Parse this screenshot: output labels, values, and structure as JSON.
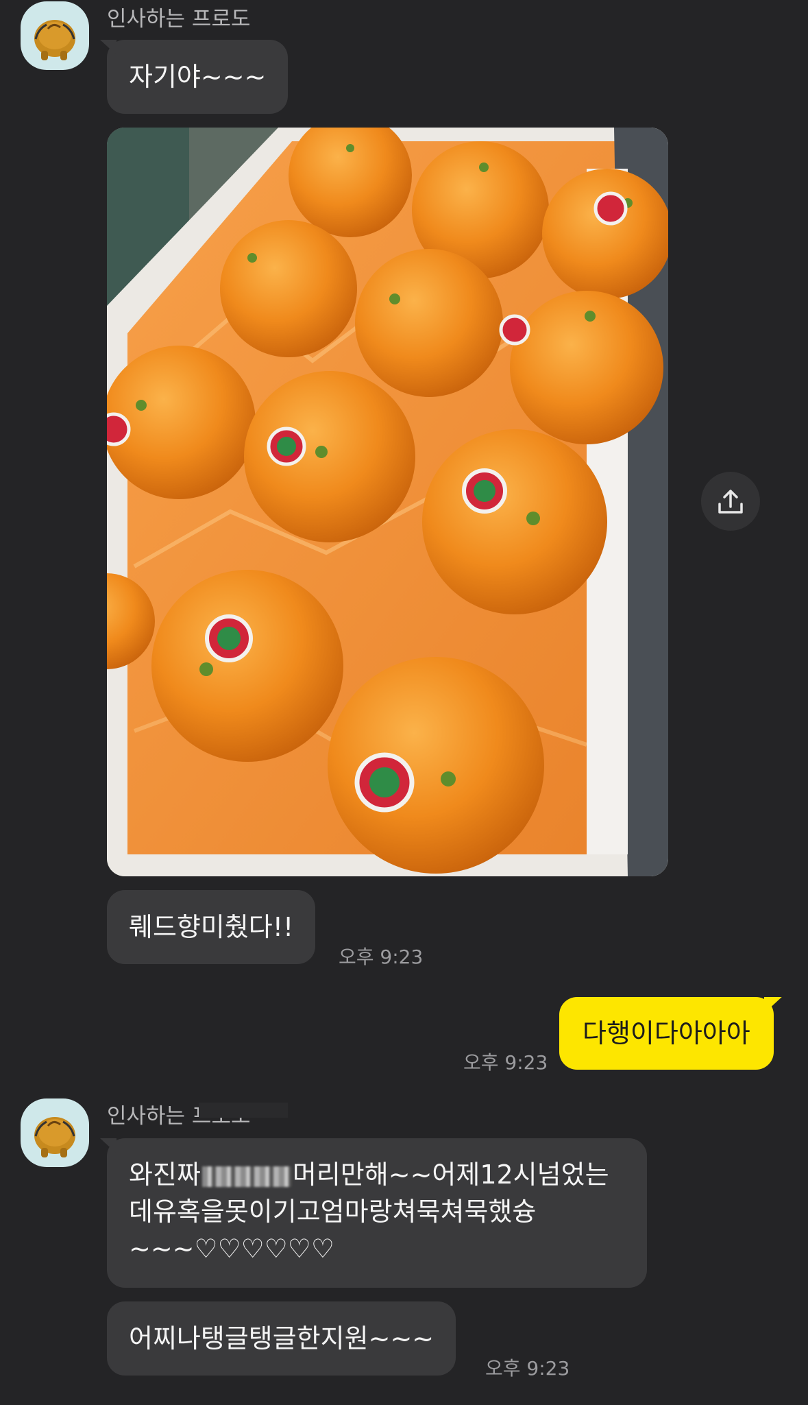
{
  "conversation": {
    "group1": {
      "sender_name": "인사하는 프로도",
      "avatar_icon": "frodo-avatar-icon",
      "messages": {
        "first": "자기야~~~",
        "photo_alt": "박스에 담긴 레드향 사진",
        "second": "뤠드향미췄다!!",
        "time": "오후 9:23"
      }
    },
    "mine": {
      "text": "다행이다아아아",
      "time": "오후 9:23"
    },
    "group2": {
      "sender_name": "인사하는 프로도",
      "avatar_icon": "frodo-avatar-icon",
      "messages": {
        "line1_start": "와진짜",
        "line1_end": "머리만해~~어제12시넘었는",
        "line2": "데유혹을못이기고엄마랑쳐묵쳐묵했슝",
        "line3": "~~~♡♡♡♡♡♡",
        "second": "어찌나탱글탱글한지원~~~",
        "time": "오후 9:23"
      }
    }
  },
  "icons": {
    "share": "share-upload-icon"
  },
  "colors": {
    "background": "#242426",
    "bubble_other": "#3a3a3c",
    "bubble_mine": "#fde600",
    "time_text": "#9c9c9f",
    "orange": "#f08a1c"
  }
}
